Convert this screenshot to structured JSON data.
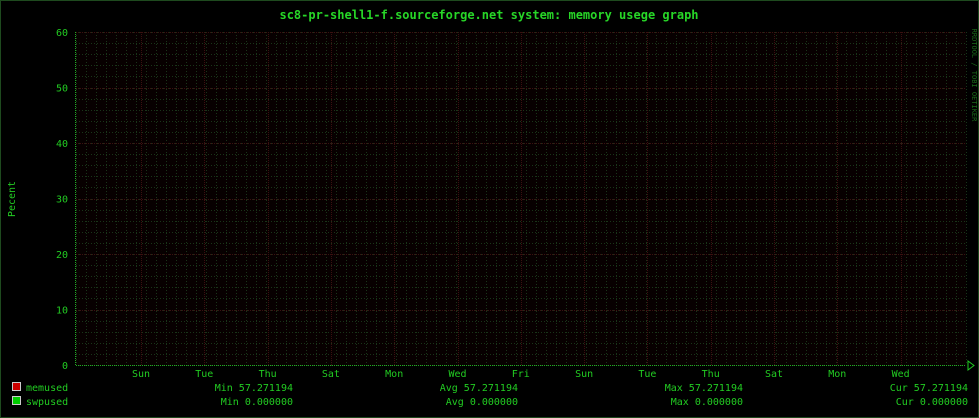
{
  "chart_data": {
    "type": "line",
    "title": "sc8-pr-shell1-f.sourceforge.net system: memory usege graph",
    "ylabel": "Pecent",
    "xlabel": "",
    "ylim": [
      0,
      60
    ],
    "yticks": [
      0,
      10,
      20,
      30,
      40,
      50,
      60
    ],
    "xticks": [
      "Sun",
      "Tue",
      "Thu",
      "Sat",
      "Mon",
      "Wed",
      "Fri",
      "Sun",
      "Tue",
      "Thu",
      "Sat",
      "Mon",
      "Wed"
    ],
    "grid": true,
    "watermark": "RRDTOOL / TOBI OETIKER",
    "series": [
      {
        "name": "memused",
        "color": "#cc0000",
        "values": [],
        "stats": {
          "min": "Min 57.271194",
          "avg": "Avg 57.271194",
          "max": "Max 57.271194",
          "cur": "Cur 57.271194"
        }
      },
      {
        "name": "swpused",
        "color": "#00cc00",
        "values": [],
        "stats": {
          "min": "Min 0.000000",
          "avg": "Avg 0.000000",
          "max": "Max 0.000000",
          "cur": "Cur 0.000000"
        }
      }
    ]
  }
}
